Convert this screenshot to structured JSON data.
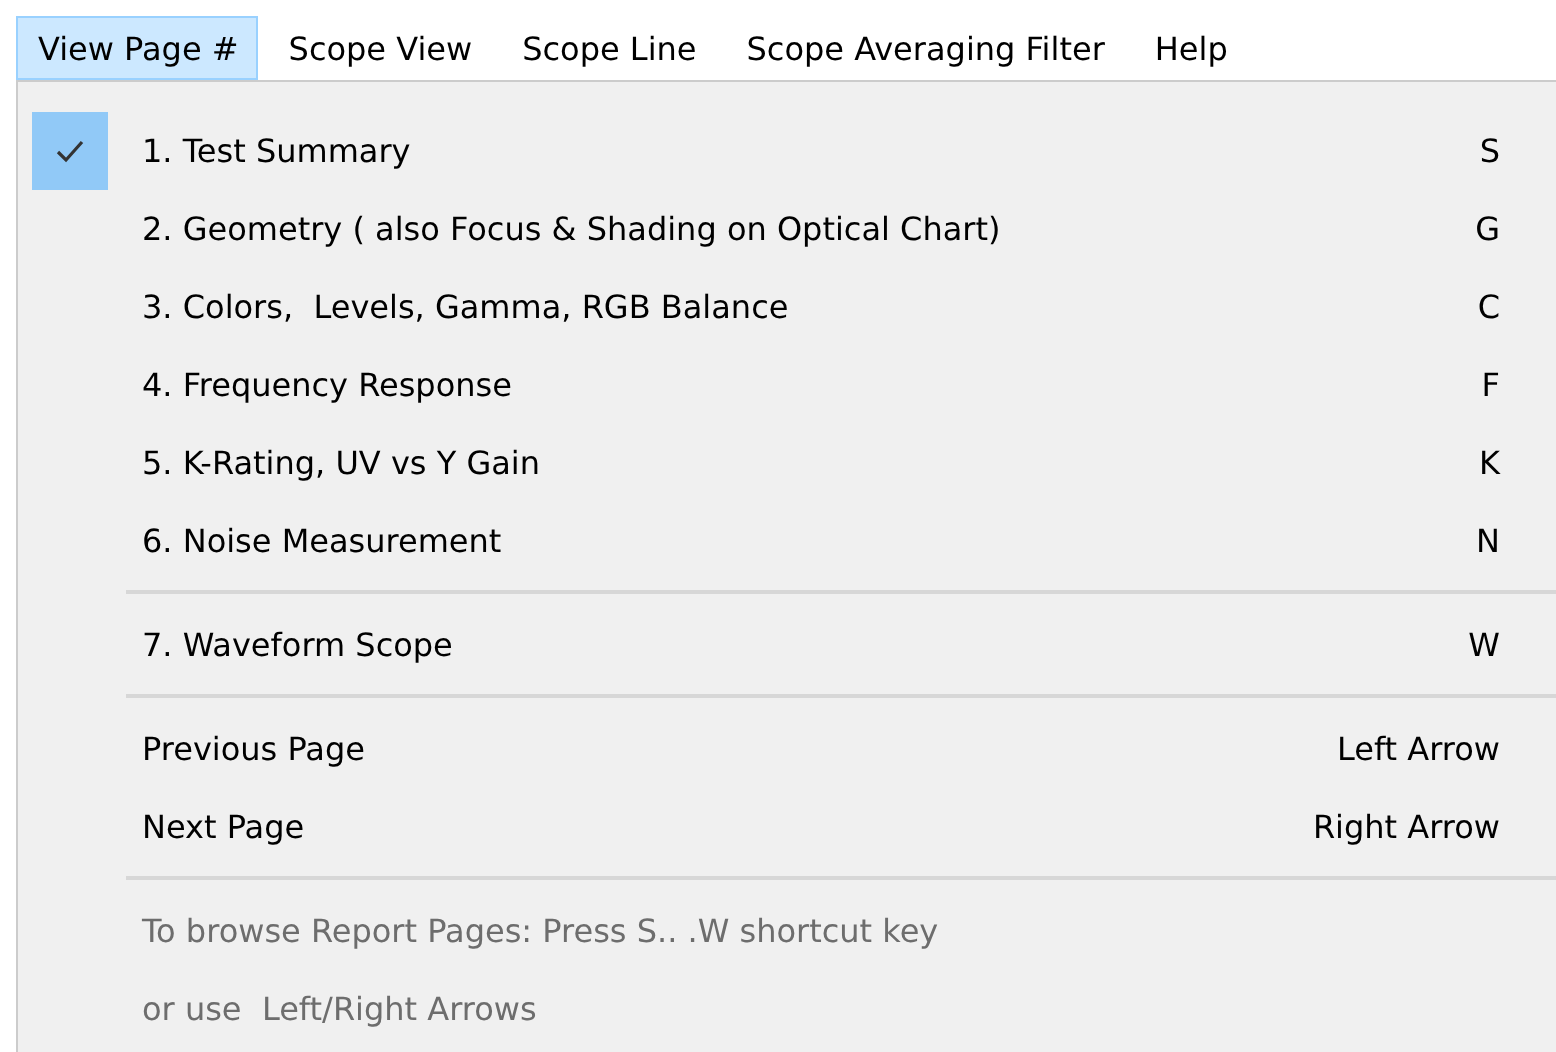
{
  "menu_bar": [
    {
      "label": "View Page #",
      "selected": true
    },
    {
      "label": "Scope View",
      "selected": false
    },
    {
      "label": "Scope Line",
      "selected": false
    },
    {
      "label": "Scope Averaging Filter",
      "selected": false
    },
    {
      "label": "Help",
      "selected": false
    }
  ],
  "dropdown": [
    {
      "kind": "item",
      "label": "1. Test Summary",
      "shortcut": "S",
      "checked": true,
      "disabled": false
    },
    {
      "kind": "item",
      "label": "2. Geometry ( also Focus & Shading on Optical Chart)",
      "shortcut": "G",
      "checked": false,
      "disabled": false
    },
    {
      "kind": "item",
      "label": "3. Colors,  Levels, Gamma, RGB Balance",
      "shortcut": "C",
      "checked": false,
      "disabled": false
    },
    {
      "kind": "item",
      "label": "4. Frequency Response",
      "shortcut": "F",
      "checked": false,
      "disabled": false
    },
    {
      "kind": "item",
      "label": "5. K-Rating, UV vs Y Gain",
      "shortcut": "K",
      "checked": false,
      "disabled": false
    },
    {
      "kind": "item",
      "label": "6. Noise Measurement",
      "shortcut": "N",
      "checked": false,
      "disabled": false
    },
    {
      "kind": "separator"
    },
    {
      "kind": "item",
      "label": "7. Waveform Scope",
      "shortcut": "W",
      "checked": false,
      "disabled": false
    },
    {
      "kind": "separator"
    },
    {
      "kind": "item",
      "label": "Previous Page",
      "shortcut": "Left Arrow",
      "checked": false,
      "disabled": false
    },
    {
      "kind": "item",
      "label": "Next Page",
      "shortcut": "Right Arrow",
      "checked": false,
      "disabled": false
    },
    {
      "kind": "separator"
    },
    {
      "kind": "item",
      "label": "To browse Report Pages: Press S.. .W shortcut key",
      "checked": false,
      "disabled": true
    },
    {
      "kind": "item",
      "label": "or use  Left/Right Arrows",
      "checked": false,
      "disabled": true
    }
  ]
}
